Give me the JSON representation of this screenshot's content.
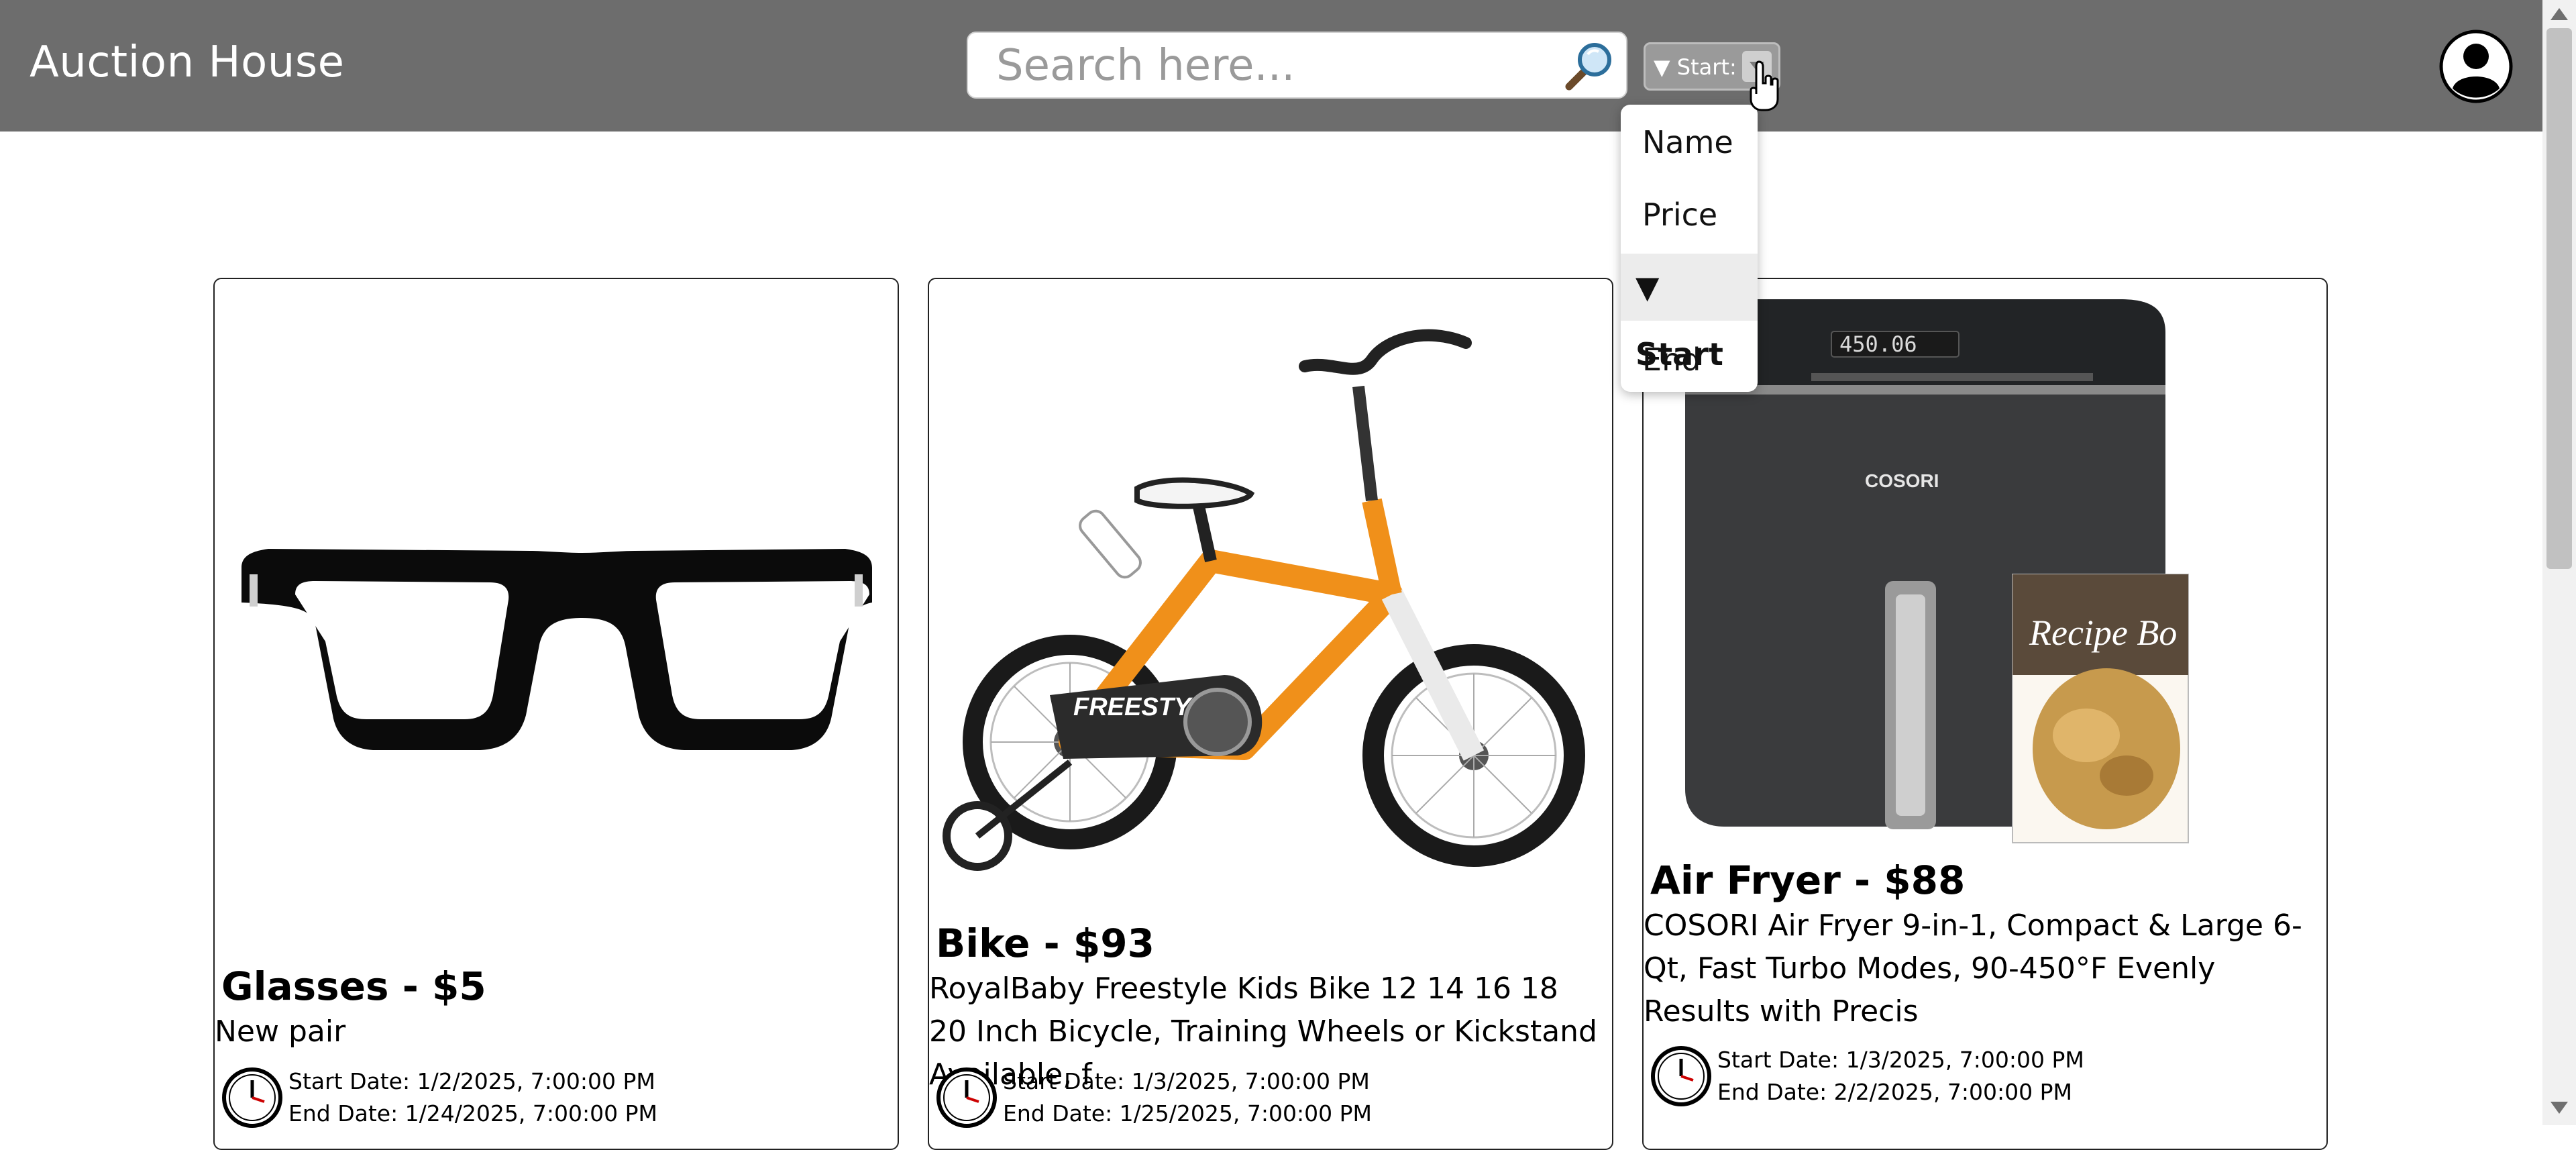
{
  "header": {
    "app_title": "Auction House",
    "search": {
      "placeholder": "Search here..."
    },
    "sort": {
      "current_label": "▼ Start:"
    }
  },
  "sort_menu": {
    "options": [
      "Name",
      "Price",
      "▼ Start",
      "End"
    ],
    "selected": "▼ Start"
  },
  "listings": [
    {
      "title": "Glasses - $5",
      "description": "New pair",
      "start_date": "Start Date: 1/2/2025, 7:00:00 PM",
      "end_date": "End Date: 1/24/2025, 7:00:00 PM",
      "image_icon": "glasses-image"
    },
    {
      "title": "Bike - $93",
      "description": "RoyalBaby Freestyle Kids Bike 12 14 16 18 20 Inch Bicycle, Training Wheels or Kickstand Available, f",
      "start_date": "Start Date: 1/3/2025, 7:00:00 PM",
      "end_date": "End Date: 1/25/2025, 7:00:00 PM",
      "image_icon": "bike-image",
      "image_text": "FREESTYLE"
    },
    {
      "title": "Air Fryer - $88",
      "description": "COSORI Air Fryer 9-in-1, Compact & Large 6-Qt, Fast Turbo Modes, 90-450°F Evenly Results with Precis",
      "start_date": "Start Date: 1/3/2025, 7:00:00 PM",
      "end_date": "End Date: 2/2/2025, 7:00:00 PM",
      "image_icon": "air-fryer-image",
      "image_text": [
        "COSORI",
        "450.06",
        "Recipe Bo"
      ]
    }
  ],
  "colors": {
    "header_bg": "#6d6d6d",
    "bike_orange": "#f0901a",
    "fryer_body": "#3a3b3d"
  }
}
